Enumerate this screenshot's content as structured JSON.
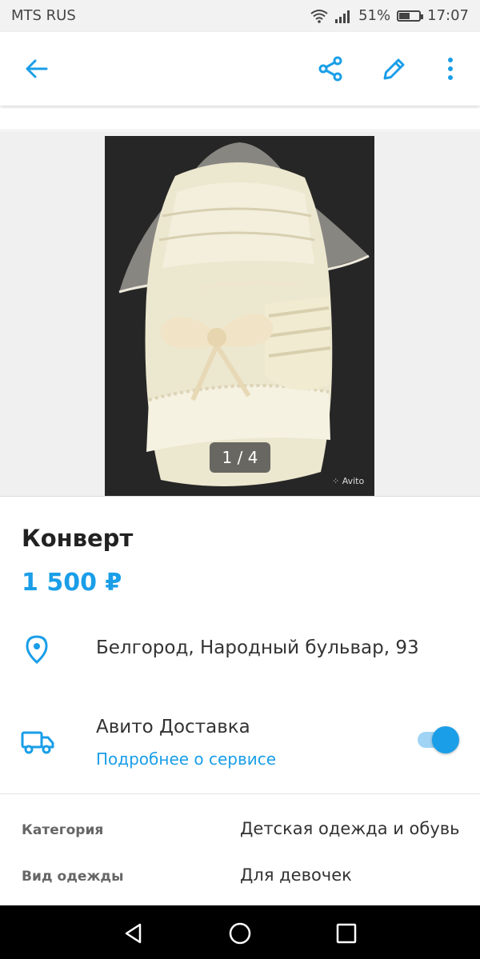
{
  "status_bar": {
    "carrier": "MTS RUS",
    "battery": "51%",
    "time": "17:07",
    "icons": [
      "wifi-icon",
      "signal-icon",
      "battery-icon"
    ]
  },
  "toolbar": {
    "icons": [
      "back-arrow-icon",
      "share-icon",
      "edit-icon",
      "more-vert-icon"
    ],
    "accent": "#1a9ee8"
  },
  "gallery": {
    "counter": "1 / 4",
    "watermark": "Avito"
  },
  "listing": {
    "title": "Конверт",
    "price": "1 500 ₽",
    "address": "Белгород, Народный бульвар, 93"
  },
  "delivery": {
    "title": "Авито Доставка",
    "link": "Подробнее о сервисе",
    "enabled": true
  },
  "properties": [
    {
      "key": "Категория",
      "value": "Детская одежда и обувь"
    },
    {
      "key": "Вид одежды",
      "value": "Для девочек"
    }
  ],
  "nav_bar": {
    "icons": [
      "back-triangle-icon",
      "home-circle-icon",
      "recents-square-icon"
    ]
  }
}
